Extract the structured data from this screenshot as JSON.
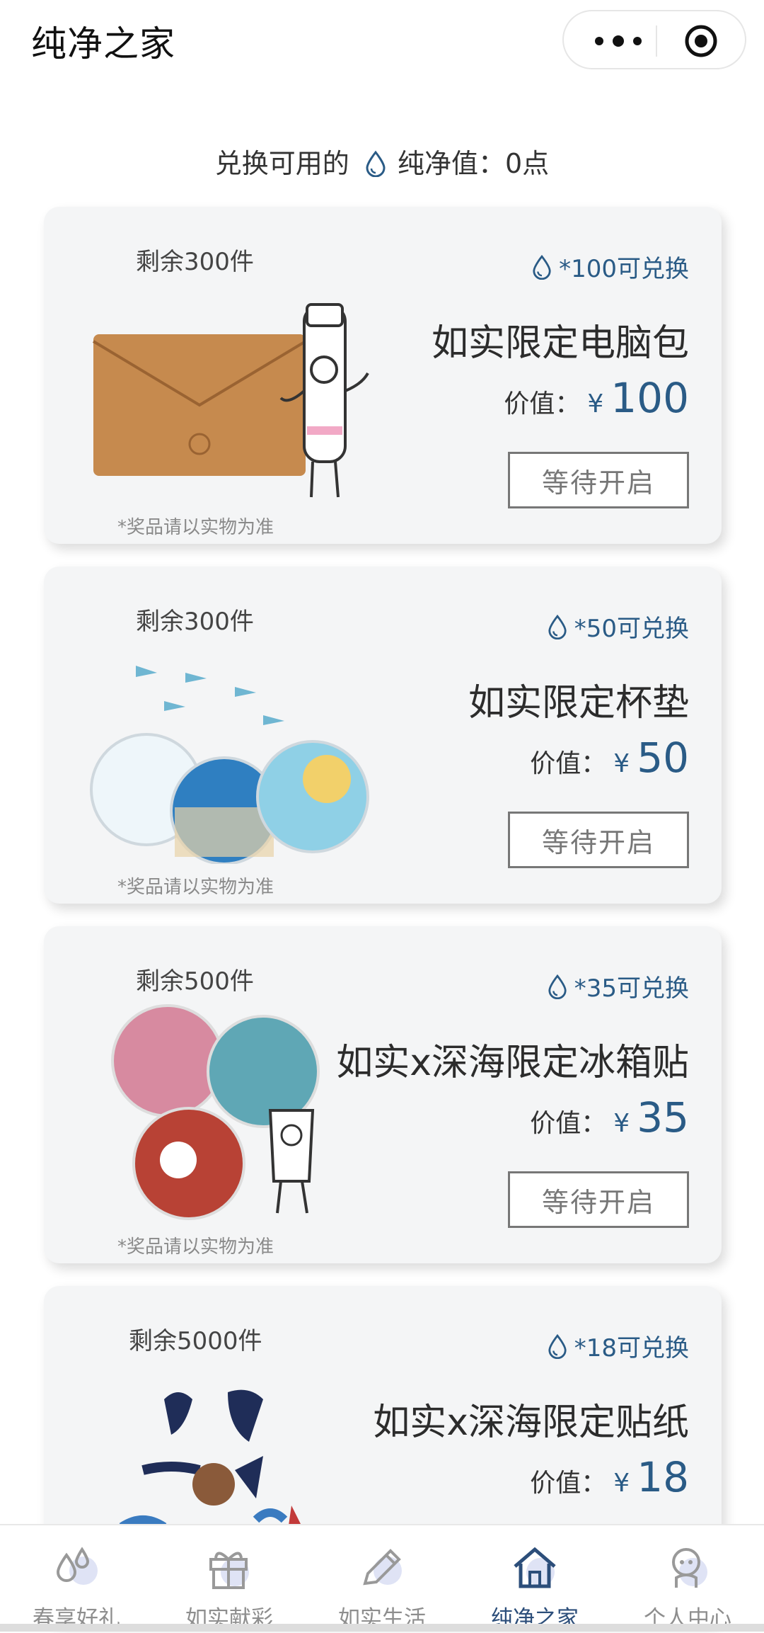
{
  "header": {
    "title": "纯净之家",
    "more_icon": "more-dots-icon",
    "target_icon": "target-icon"
  },
  "points": {
    "label": "兑换可用的",
    "icon": "water-drop-icon",
    "value_text": "纯净值：0点"
  },
  "cards": [
    {
      "remaining": "剩余300件",
      "exchange": "*100可兑换",
      "name": "如实限定电脑包",
      "value_label": "价值：",
      "currency": "¥",
      "value": "100",
      "button": "等待开启",
      "note": "*奖品请以实物为准",
      "image": "laptop-bag-image"
    },
    {
      "remaining": "剩余300件",
      "exchange": "*50可兑换",
      "name": "如实限定杯垫",
      "value_label": "价值：",
      "currency": "¥",
      "value": "50",
      "button": "等待开启",
      "note": "*奖品请以实物为准",
      "image": "coasters-image"
    },
    {
      "remaining": "剩余500件",
      "exchange": "*35可兑换",
      "name": "如实x深海限定冰箱贴",
      "value_label": "价值：",
      "currency": "¥",
      "value": "35",
      "button": "等待开启",
      "note": "*奖品请以实物为准",
      "image": "fridge-magnets-image"
    },
    {
      "remaining": "剩余5000件",
      "exchange": "*18可兑换",
      "name": "如实x深海限定贴纸",
      "value_label": "价值：",
      "currency": "¥",
      "value": "18",
      "image": "stickers-image"
    }
  ],
  "tabs": [
    {
      "label": "春享好礼",
      "icon": "drops-icon",
      "active": false
    },
    {
      "label": "如实献彩",
      "icon": "gift-icon",
      "active": false
    },
    {
      "label": "如实生活",
      "icon": "pencil-icon",
      "active": false
    },
    {
      "label": "纯净之家",
      "icon": "home-icon",
      "active": true
    },
    {
      "label": "个人中心",
      "icon": "avatar-icon",
      "active": false
    }
  ],
  "colors": {
    "accent": "#2a5b86",
    "active_tab": "#2c4e7a",
    "card_bg": "#f4f5f6"
  }
}
